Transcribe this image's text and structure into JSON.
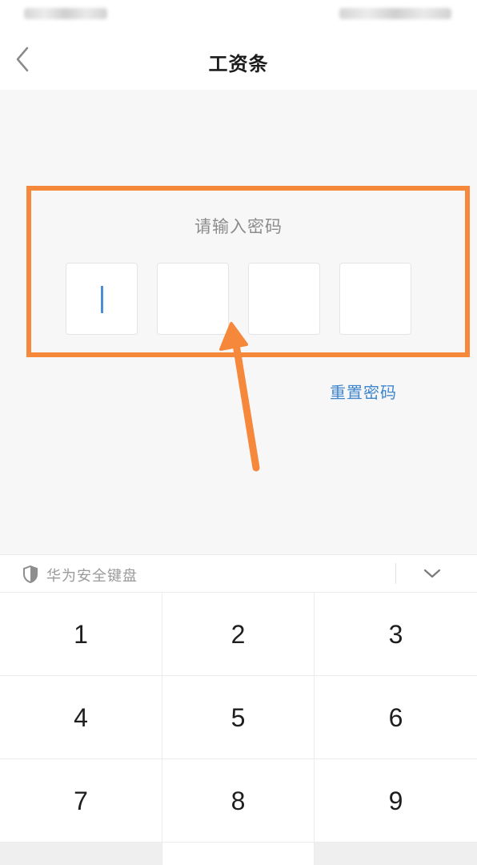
{
  "nav": {
    "title": "工资条",
    "back_icon": "chevron-left-icon"
  },
  "pin_entry": {
    "prompt": "请输入密码",
    "digits_total": 4,
    "digits_entered": 0,
    "reset_link": "重置密码"
  },
  "annotation": {
    "color": "#f5883a"
  },
  "keyboard": {
    "name": "华为安全键盘",
    "brand_icon": "shield-icon",
    "collapse_icon": "chevron-down-icon",
    "keys": [
      "1",
      "2",
      "3",
      "4",
      "5",
      "6",
      "7",
      "8",
      "9"
    ]
  },
  "colors": {
    "link": "#3f86cf",
    "caret": "#4a8fd6",
    "background": "#f7f7f7"
  }
}
